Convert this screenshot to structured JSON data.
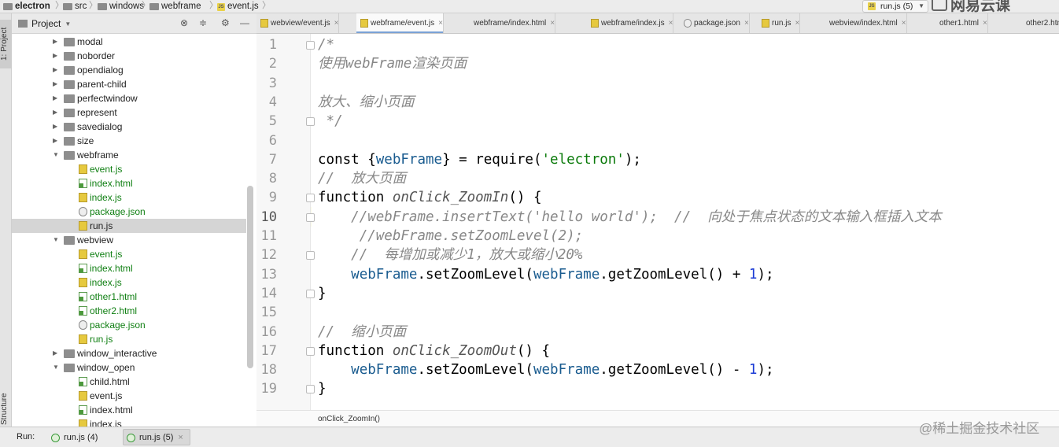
{
  "breadcrumb": {
    "items": [
      "electron",
      "src",
      "windows",
      "webframe",
      "event.js"
    ],
    "separator": "〉"
  },
  "run_config": {
    "label": "run.js (5)",
    "icon": "js-file-icon"
  },
  "watermark_top": "网易云课",
  "sidebar_strip": {
    "project_label": "1: Project",
    "structure_label": "Structure"
  },
  "project_panel": {
    "title": "Project",
    "icons": [
      "target-icon",
      "collapse-icon",
      "gear-icon",
      "minimize-icon"
    ]
  },
  "tree": [
    {
      "label": "modal",
      "kind": "folder",
      "depth": 0,
      "expanded": false
    },
    {
      "label": "noborder",
      "kind": "folder",
      "depth": 0,
      "expanded": false
    },
    {
      "label": "opendialog",
      "kind": "folder",
      "depth": 0,
      "expanded": false
    },
    {
      "label": "parent-child",
      "kind": "folder",
      "depth": 0,
      "expanded": false
    },
    {
      "label": "perfectwindow",
      "kind": "folder",
      "depth": 0,
      "expanded": false
    },
    {
      "label": "represent",
      "kind": "folder",
      "depth": 0,
      "expanded": false
    },
    {
      "label": "savedialog",
      "kind": "folder",
      "depth": 0,
      "expanded": false
    },
    {
      "label": "size",
      "kind": "folder",
      "depth": 0,
      "expanded": false
    },
    {
      "label": "webframe",
      "kind": "folder",
      "depth": 0,
      "expanded": true
    },
    {
      "label": "event.js",
      "kind": "js",
      "depth": 1,
      "green": true
    },
    {
      "label": "index.html",
      "kind": "html",
      "depth": 1,
      "green": true
    },
    {
      "label": "index.js",
      "kind": "js",
      "depth": 1,
      "green": true
    },
    {
      "label": "package.json",
      "kind": "json",
      "depth": 1,
      "green": true
    },
    {
      "label": "run.js",
      "kind": "js",
      "depth": 1,
      "green": false,
      "selected": true
    },
    {
      "label": "webview",
      "kind": "folder",
      "depth": 0,
      "expanded": true
    },
    {
      "label": "event.js",
      "kind": "js",
      "depth": 1,
      "green": true
    },
    {
      "label": "index.html",
      "kind": "html",
      "depth": 1,
      "green": true
    },
    {
      "label": "index.js",
      "kind": "js",
      "depth": 1,
      "green": true
    },
    {
      "label": "other1.html",
      "kind": "html",
      "depth": 1,
      "green": true
    },
    {
      "label": "other2.html",
      "kind": "html",
      "depth": 1,
      "green": true
    },
    {
      "label": "package.json",
      "kind": "json",
      "depth": 1,
      "green": true
    },
    {
      "label": "run.js",
      "kind": "js",
      "depth": 1,
      "green": true
    },
    {
      "label": "window_interactive",
      "kind": "folder",
      "depth": 0,
      "expanded": false
    },
    {
      "label": "window_open",
      "kind": "folder",
      "depth": 0,
      "expanded": true
    },
    {
      "label": "child.html",
      "kind": "html",
      "depth": 1,
      "green": false
    },
    {
      "label": "event.js",
      "kind": "js",
      "depth": 1,
      "green": false
    },
    {
      "label": "index.html",
      "kind": "html",
      "depth": 1,
      "green": false
    },
    {
      "label": "index.js",
      "kind": "js",
      "depth": 1,
      "green": false
    }
  ],
  "tabs": [
    {
      "label": "webview/event.js",
      "kind": "js",
      "active": false,
      "closable": true
    },
    {
      "label": "webframe/event.js",
      "kind": "js",
      "active": true,
      "closable": true
    },
    {
      "label": "webframe/index.html",
      "kind": "html",
      "active": false,
      "closable": true
    },
    {
      "label": "webframe/index.js",
      "kind": "js",
      "active": false,
      "closable": true
    },
    {
      "label": "package.json",
      "kind": "json",
      "active": false,
      "closable": true
    },
    {
      "label": "run.js",
      "kind": "js",
      "active": false,
      "closable": true
    },
    {
      "label": "webview/index.html",
      "kind": "html",
      "active": false,
      "closable": true
    },
    {
      "label": "other1.html",
      "kind": "html",
      "active": false,
      "closable": true
    },
    {
      "label": "other2.htm",
      "kind": "html",
      "active": false,
      "closable": false
    }
  ],
  "editor": {
    "current_line": 10,
    "lines": [
      {
        "n": "1",
        "fold": true,
        "tokens": [
          [
            "cm",
            "/*"
          ]
        ]
      },
      {
        "n": "2",
        "fold": false,
        "tokens": [
          [
            "cm",
            "使用webFrame渲染页面"
          ]
        ]
      },
      {
        "n": "3",
        "fold": false,
        "tokens": []
      },
      {
        "n": "4",
        "fold": false,
        "tokens": [
          [
            "cm",
            "放大、缩小页面"
          ]
        ]
      },
      {
        "n": "5",
        "fold": true,
        "tokens": [
          [
            "cm",
            " */"
          ]
        ]
      },
      {
        "n": "6",
        "fold": false,
        "tokens": []
      },
      {
        "n": "7",
        "fold": false,
        "tokens": [
          [
            "kw",
            "const "
          ],
          [
            "p",
            "{"
          ],
          [
            "va",
            "webFrame"
          ],
          [
            "p",
            "} = require("
          ],
          [
            "st",
            "'electron'"
          ],
          [
            "p",
            ");"
          ]
        ]
      },
      {
        "n": "8",
        "fold": false,
        "tokens": [
          [
            "cm",
            "//  放大页面"
          ]
        ]
      },
      {
        "n": "9",
        "fold": true,
        "tokens": [
          [
            "kw",
            "function "
          ],
          [
            "fn",
            "onClick_ZoomIn"
          ],
          [
            "p",
            "() {"
          ]
        ]
      },
      {
        "n": "10",
        "fold": true,
        "tokens": [
          [
            "p",
            "    "
          ],
          [
            "cm",
            "//webFrame.insertText('hello world');  //  向处于焦点状态的文本输入框插入文本"
          ]
        ]
      },
      {
        "n": "11",
        "fold": false,
        "tokens": [
          [
            "p",
            "     "
          ],
          [
            "cm",
            "//webFrame.setZoomLevel(2);"
          ]
        ]
      },
      {
        "n": "12",
        "fold": true,
        "tokens": [
          [
            "p",
            "    "
          ],
          [
            "cm",
            "//  每增加或减少1，放大或缩小20%"
          ]
        ]
      },
      {
        "n": "13",
        "fold": false,
        "tokens": [
          [
            "p",
            "    "
          ],
          [
            "va",
            "webFrame"
          ],
          [
            "p",
            ".setZoomLevel("
          ],
          [
            "va",
            "webFrame"
          ],
          [
            "p",
            ".getZoomLevel() + "
          ],
          [
            "nu",
            "1"
          ],
          [
            "p",
            ");"
          ]
        ]
      },
      {
        "n": "14",
        "fold": true,
        "tokens": [
          [
            "p",
            "}"
          ]
        ]
      },
      {
        "n": "15",
        "fold": false,
        "tokens": []
      },
      {
        "n": "16",
        "fold": false,
        "tokens": [
          [
            "cm",
            "//  缩小页面"
          ]
        ]
      },
      {
        "n": "17",
        "fold": true,
        "tokens": [
          [
            "kw",
            "function "
          ],
          [
            "fn",
            "onClick_ZoomOut"
          ],
          [
            "p",
            "() {"
          ]
        ]
      },
      {
        "n": "18",
        "fold": false,
        "tokens": [
          [
            "p",
            "    "
          ],
          [
            "va",
            "webFrame"
          ],
          [
            "p",
            ".setZoomLevel("
          ],
          [
            "va",
            "webFrame"
          ],
          [
            "p",
            ".getZoomLevel() - "
          ],
          [
            "nu",
            "1"
          ],
          [
            "p",
            ");"
          ]
        ]
      },
      {
        "n": "19",
        "fold": true,
        "tokens": [
          [
            "p",
            "}"
          ]
        ]
      }
    ]
  },
  "editor_breadcrumb": "onClick_ZoomIn()",
  "run_bar": {
    "label": "Run:",
    "tabs": [
      {
        "label": "run.js (4)",
        "active": false
      },
      {
        "label": "run.js (5)",
        "active": true
      }
    ]
  },
  "watermark_bottom": "@稀土掘金技术社区"
}
